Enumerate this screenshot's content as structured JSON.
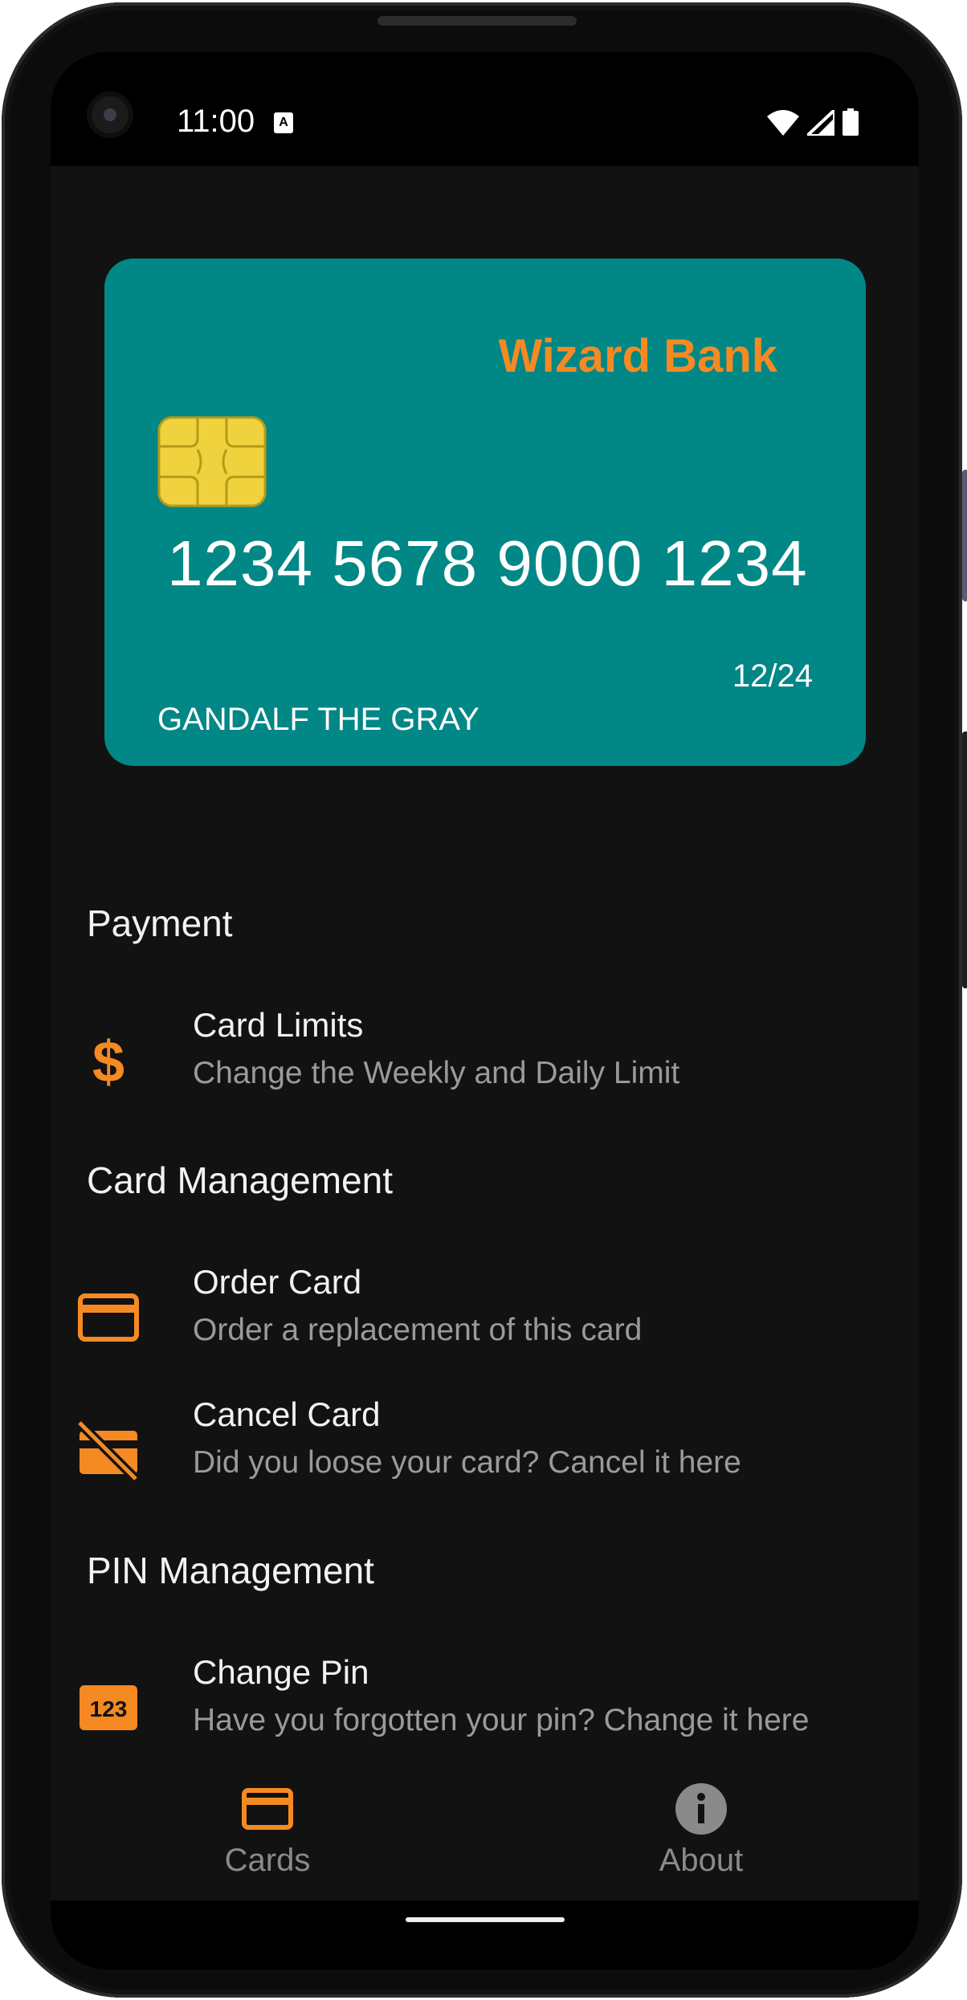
{
  "status_bar": {
    "time": "11:00",
    "notification_icon": "a-icon"
  },
  "card": {
    "bank_name": "Wizard Bank",
    "number": "1234 5678 9000 1234",
    "expiry": "12/24",
    "holder": "GANDALF THE GRAY",
    "colors": {
      "card": "#018786",
      "bank_name": "#f58a23",
      "chip": "#f0d23e"
    }
  },
  "sections": {
    "payment": {
      "title": "Payment",
      "items": [
        {
          "icon": "dollar-icon",
          "title": "Card Limits",
          "subtitle": "Change the Weekly and Daily Limit"
        }
      ]
    },
    "card_management": {
      "title": "Card Management",
      "items": [
        {
          "icon": "credit-card-icon",
          "title": "Order Card",
          "subtitle": "Order a replacement of this card"
        },
        {
          "icon": "credit-card-off-icon",
          "title": "Cancel Card",
          "subtitle": "Did you loose your card? Cancel it here"
        }
      ]
    },
    "pin_management": {
      "title": "PIN Management",
      "items": [
        {
          "icon": "pin-123-icon",
          "title": "Change Pin",
          "subtitle": "Have you forgotten your pin? Change it here"
        }
      ]
    }
  },
  "bottom_nav": [
    {
      "icon": "credit-card-icon",
      "label": "Cards",
      "selected": true
    },
    {
      "icon": "info-icon",
      "label": "About",
      "selected": false
    }
  ],
  "accent_color": "#f58a23"
}
